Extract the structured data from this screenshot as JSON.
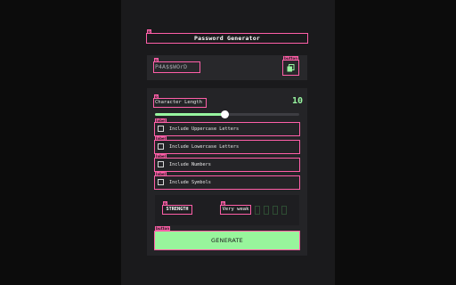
{
  "app": {
    "title": "Password Generator"
  },
  "output": {
    "password": "P4A$$WOrD",
    "copy_icon": "copy-icon"
  },
  "settings": {
    "length_label": "Character Length",
    "length_value": "10",
    "slider_fraction": 0.48,
    "options": [
      {
        "label": "Include Uppercase Letters",
        "checked": false
      },
      {
        "label": "Include Lowercase Letters",
        "checked": false
      },
      {
        "label": "Include Numbers",
        "checked": false
      },
      {
        "label": "Include Symbols",
        "checked": false
      }
    ]
  },
  "strength": {
    "label": "STRENGTH",
    "value": "Very weak",
    "bars_filled": 0,
    "bars_total": 4
  },
  "actions": {
    "generate_label": "GENERATE"
  },
  "debug_tags": {
    "title_tag": "p",
    "password_tag": "p",
    "copy_tag": "button",
    "length_tag": "p",
    "option_tag": "label",
    "strength_tag": "p",
    "strength_value_tag": "p",
    "generate_tag": "button"
  },
  "colors": {
    "background": "#0c0c0c",
    "panel": "#1a1a1c",
    "card": "#28282b",
    "accent_green": "#98f5a0",
    "debug_outline": "#ff5fa8"
  }
}
